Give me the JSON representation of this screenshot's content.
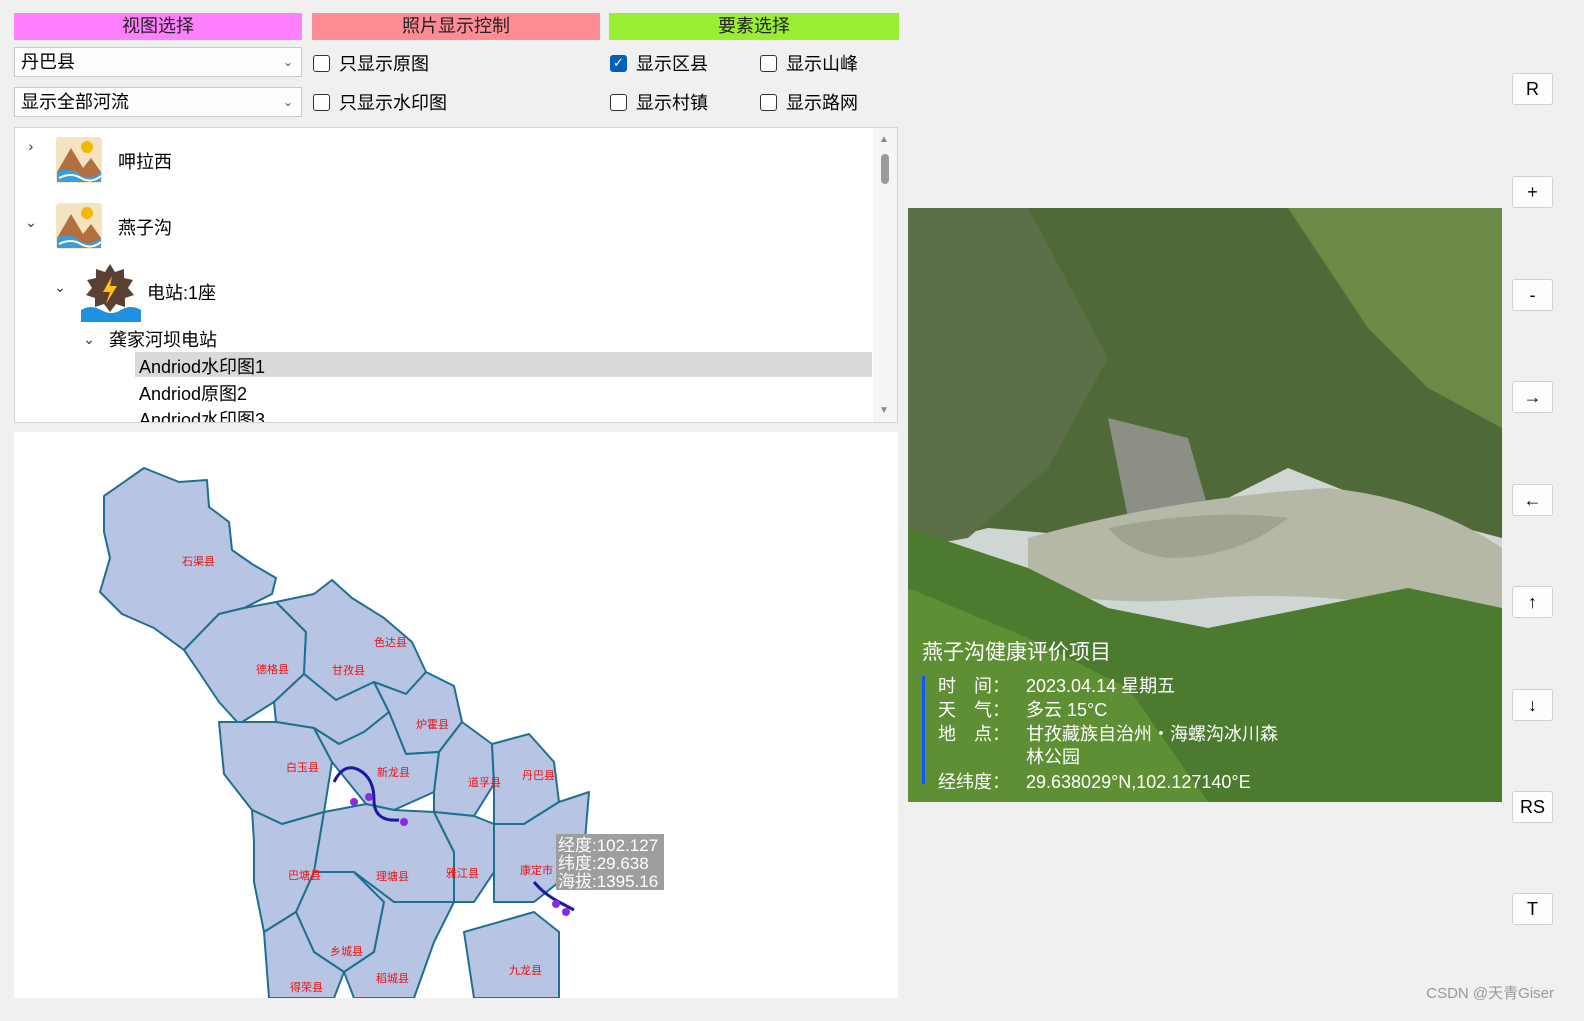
{
  "headers": {
    "view": {
      "label": "视图选择",
      "color": "#ff80ff"
    },
    "photo": {
      "label": "照片显示控制",
      "color": "#ff8c94"
    },
    "feature": {
      "label": "要素选择",
      "color": "#99ee33"
    }
  },
  "combos": {
    "county": "丹巴县",
    "river": "显示全部河流"
  },
  "checkboxes": {
    "only_original": {
      "label": "只显示原图",
      "checked": false
    },
    "only_watermark": {
      "label": "只显示水印图",
      "checked": false
    },
    "show_county": {
      "label": "显示区县",
      "checked": true
    },
    "show_peak": {
      "label": "显示山峰",
      "checked": false
    },
    "show_village": {
      "label": "显示村镇",
      "checked": false
    },
    "show_road": {
      "label": "显示路网",
      "checked": false
    }
  },
  "tree": {
    "items": [
      "呷拉西",
      "燕子沟",
      "电站:1座",
      "龚家河坝电站",
      "Andriod水印图1",
      "Andriod原图2",
      "Andriod水印图3"
    ]
  },
  "map": {
    "counties": [
      "石渠县",
      "色达县",
      "德格县",
      "甘孜县",
      "炉霍县",
      "白玉县",
      "新龙县",
      "道孚县",
      "丹巴县",
      "巴塘县",
      "理塘县",
      "雅江县",
      "康定市",
      "乡城县",
      "稻城县",
      "九龙县",
      "得荣县"
    ],
    "tooltip": {
      "lon": "经度:102.127",
      "lat": "纬度:29.638",
      "alt": "海拔:1395.16"
    }
  },
  "photo": {
    "title": "燕子沟健康评价项目",
    "time_label": "时　间：",
    "time": "2023.04.14 星期五",
    "weather_label": "天　气：",
    "weather": "多云 15°C",
    "place_label": "地　点：",
    "place1": "甘孜藏族自治州・海螺沟冰川森",
    "place2": "林公园",
    "coord_label": "经纬度：",
    "coord": "29.638029°N,102.127140°E"
  },
  "buttons": [
    "R",
    "+",
    "-",
    "→",
    "←",
    "↑",
    "↓",
    "RS",
    "T"
  ],
  "watermark": "CSDN @天青Giser"
}
